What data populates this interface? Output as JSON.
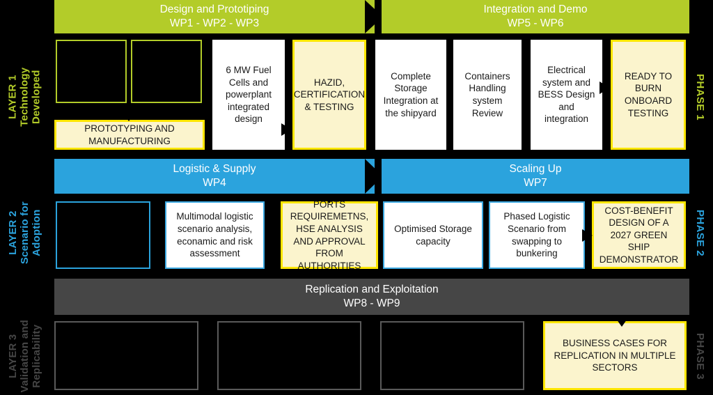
{
  "layers": [
    {
      "id": "layer-1",
      "rail_label": "LAYER 1\nTechnology\nDeveloped",
      "rail_line1": "LAYER 1",
      "rail_line2": "Technology",
      "rail_line3": "Developed",
      "rail_color": "#b3cc29",
      "phase_label": "PHASE 1",
      "phase_color": "#b3cc29",
      "bands": [
        {
          "title": "Design and Prototiping",
          "subtitle": "WP1 - WP2 - WP3"
        },
        {
          "title": "Integration and Demo",
          "subtitle": "WP5 - WP6"
        }
      ],
      "boxes": [
        {
          "text": "",
          "style": "empty-green"
        },
        {
          "text": "",
          "style": "empty-green"
        },
        {
          "text": "6 MW Fuel Cells and powerplant integrated design",
          "style": "white"
        },
        {
          "text": "HAZID, CERTIFICATION & TESTING",
          "style": "yellow"
        },
        {
          "text": "Complete Storage Integration at the shipyard",
          "style": "white"
        },
        {
          "text": "Containers Handling system Review",
          "style": "white"
        },
        {
          "text": "Electrical system and BESS Design and integration",
          "style": "white"
        },
        {
          "text": "READY TO BURN ONBOARD TESTING",
          "style": "yellow"
        },
        {
          "text": "PROTOTYPING AND MANUFACTURING",
          "style": "yellow"
        }
      ]
    },
    {
      "id": "layer-2",
      "rail_line1": "LAYER 2",
      "rail_line2": "Scenario for",
      "rail_line3": "Adoption",
      "rail_color": "#2ba3dd",
      "phase_label": "PHASE 2",
      "phase_color": "#2ba3dd",
      "bands": [
        {
          "title": "Logistic & Supply",
          "subtitle": "WP4"
        },
        {
          "title": "Scaling Up",
          "subtitle": "WP7"
        }
      ],
      "boxes": [
        {
          "text": "",
          "style": "empty-blue"
        },
        {
          "text": "Multimodal logistic scenario analysis, econamic and risk assessment",
          "style": "white-blue"
        },
        {
          "text": "PORTS REQUIREMETNS, HSE ANALYSIS AND APPROVAL FROM AUTHORITIES",
          "style": "yellow"
        },
        {
          "text": "Optimised Storage capacity",
          "style": "white-blue"
        },
        {
          "text": "Phased Logistic Scenario from swapping to bunkering",
          "style": "white-blue"
        },
        {
          "text": "COST-BENEFIT DESIGN OF A 2027 GREEN SHIP DEMONSTRATOR",
          "style": "yellow"
        }
      ]
    },
    {
      "id": "layer-3",
      "rail_line1": "LAYER 3",
      "rail_line2": "Validation and",
      "rail_line3": "Replicability",
      "rail_color": "#464646",
      "phase_label": "PHASE 3",
      "phase_color": "#464646",
      "bands": [
        {
          "title": "Replication and Exploitation",
          "subtitle": "WP8 - WP9"
        }
      ],
      "boxes": [
        {
          "text": "",
          "style": "empty-gray"
        },
        {
          "text": "",
          "style": "empty-gray"
        },
        {
          "text": "",
          "style": "empty-gray"
        },
        {
          "text": "BUSINESS CASES FOR REPLICATION IN MULTIPLE SECTORS",
          "style": "yellow"
        }
      ]
    }
  ],
  "l1": {
    "band1_title": "Design and Prototiping",
    "band1_sub": "WP1 - WP2 - WP3",
    "band2_title": "Integration and Demo",
    "band2_sub": "WP5 - WP6",
    "box1": "",
    "box2": "",
    "box3": "6 MW Fuel Cells and powerplant integrated design",
    "box4": "HAZID, CERTIFICATION & TESTING",
    "box5": "Complete Storage Integration at the shipyard",
    "box6": "Containers Handling system Review",
    "box7": "Electrical system and BESS Design and integration",
    "box8": "READY TO BURN ONBOARD TESTING",
    "box_proto": "PROTOTYPING AND MANUFACTURING",
    "rail1": "LAYER 1",
    "rail2": "Technology",
    "rail3": "Developed",
    "phase": "PHASE 1"
  },
  "l2": {
    "band1_title": "Logistic & Supply",
    "band1_sub": "WP4",
    "band2_title": "Scaling Up",
    "band2_sub": "WP7",
    "box1": "",
    "box2": "Multimodal logistic scenario analysis, econamic and risk assessment",
    "box3": "PORTS REQUIREMETNS, HSE ANALYSIS AND APPROVAL FROM AUTHORITIES",
    "box4": "Optimised Storage capacity",
    "box5": "Phased Logistic Scenario from swapping to bunkering",
    "box6": "COST-BENEFIT DESIGN OF A 2027 GREEN SHIP DEMONSTRATOR",
    "rail1": "LAYER 2",
    "rail2": "Scenario for",
    "rail3": "Adoption",
    "phase": "PHASE 2"
  },
  "l3": {
    "band1_title": "Replication and Exploitation",
    "band1_sub": "WP8 - WP9",
    "box1": "",
    "box2": "",
    "box3": "",
    "box4": "BUSINESS CASES FOR REPLICATION IN MULTIPLE SECTORS",
    "rail1": "LAYER 3",
    "rail2": "Validation and",
    "rail3": "Replicability",
    "phase": "PHASE 3"
  },
  "colors": {
    "green": "#b3cc29",
    "blue": "#2ba3dd",
    "gray": "#464646",
    "yellow_border": "#ffe600",
    "yellow_fill": "#fbf4cd",
    "background": "#000000",
    "text_light": "#ffffff",
    "text_dark": "#1a1a1a"
  }
}
